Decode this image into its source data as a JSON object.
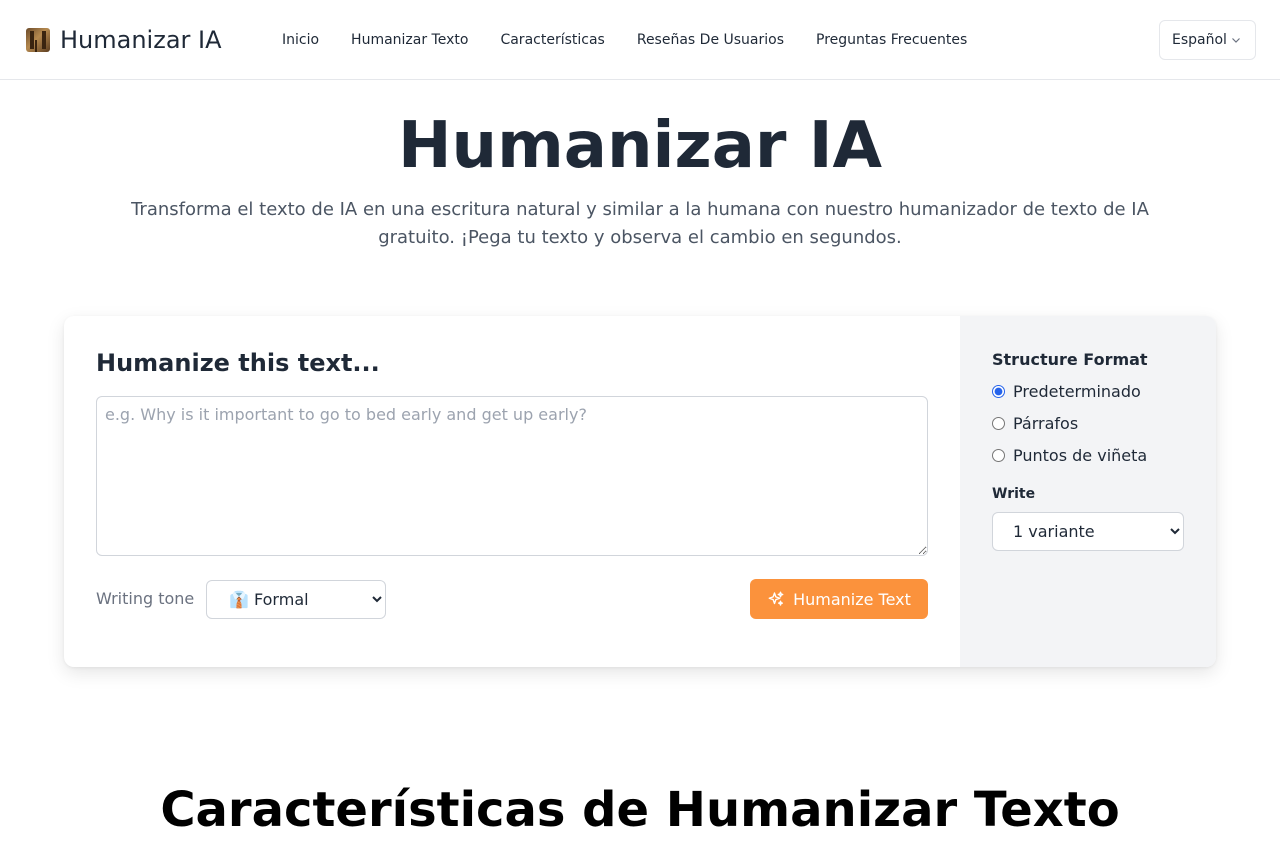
{
  "header": {
    "brand": "Humanizar IA",
    "nav": [
      "Inicio",
      "Humanizar Texto",
      "Características",
      "Reseñas De Usuarios",
      "Preguntas Frecuentes"
    ],
    "language": "Español"
  },
  "hero": {
    "title": "Humanizar IA",
    "subtitle": "Transforma el texto de IA en una escritura natural y similar a la humana con nuestro humanizador de texto de IA gratuito. ¡Pega tu texto y observa el cambio en segundos."
  },
  "tool": {
    "title": "Humanize this text...",
    "placeholder": "e.g. Why is it important to go to bed early and get up early?",
    "value": "",
    "tone_label": "Writing tone",
    "tone_value": "👔 Formal",
    "button_label": "Humanize Text",
    "accent_color": "#fb923c"
  },
  "sidebar": {
    "structure_title": "Structure Format",
    "formats": [
      {
        "label": "Predeterminado",
        "checked": true
      },
      {
        "label": "Párrafos",
        "checked": false
      },
      {
        "label": "Puntos de viñeta",
        "checked": false
      }
    ],
    "write_label": "Write",
    "variant_value": "1 variante"
  },
  "features": {
    "title": "Características de Humanizar Texto"
  }
}
